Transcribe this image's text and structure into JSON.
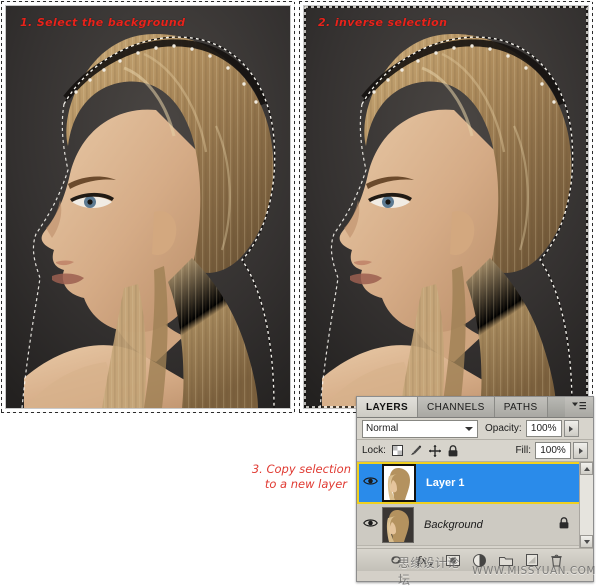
{
  "panels": [
    {
      "id": "panel-1",
      "step_label": "1. Select the background",
      "caption_color": "#e8231b"
    },
    {
      "id": "panel-2",
      "step_label": "2. inverse selection",
      "caption_color": "#e8231b"
    }
  ],
  "annotation": {
    "line1": "3. Copy selection",
    "line2": "to a new layer",
    "color": "#e03a32"
  },
  "palette": {
    "tabs": [
      {
        "label": "LAYERS",
        "active": true
      },
      {
        "label": "CHANNELS",
        "active": false
      },
      {
        "label": "PATHS",
        "active": false
      }
    ],
    "menu_icon": "panel-menu-icon",
    "blend_mode": "Normal",
    "opacity_label": "Opacity:",
    "opacity_value": "100%",
    "lock_label": "Lock:",
    "lock_icons": [
      "lock-transparent-pixels-icon",
      "lock-image-pixels-icon",
      "lock-position-icon",
      "lock-all-icon"
    ],
    "fill_label": "Fill:",
    "fill_value": "100%",
    "layers": [
      {
        "name": "Layer 1",
        "selected": true,
        "visible": true,
        "locked": false
      },
      {
        "name": "Background",
        "selected": false,
        "visible": true,
        "locked": true
      }
    ],
    "footer_icons": [
      "link-layers-icon",
      "add-layer-style-icon",
      "add-layer-mask-icon",
      "new-fill-adjustment-layer-icon",
      "new-group-icon",
      "new-layer-icon",
      "delete-layer-icon"
    ],
    "accent_selected": "#2a8bea",
    "accent_highlight": "#f0d020"
  },
  "watermark": {
    "cn": "思缘设计论坛",
    "url": "WWW.MISSYUAN.COM"
  }
}
